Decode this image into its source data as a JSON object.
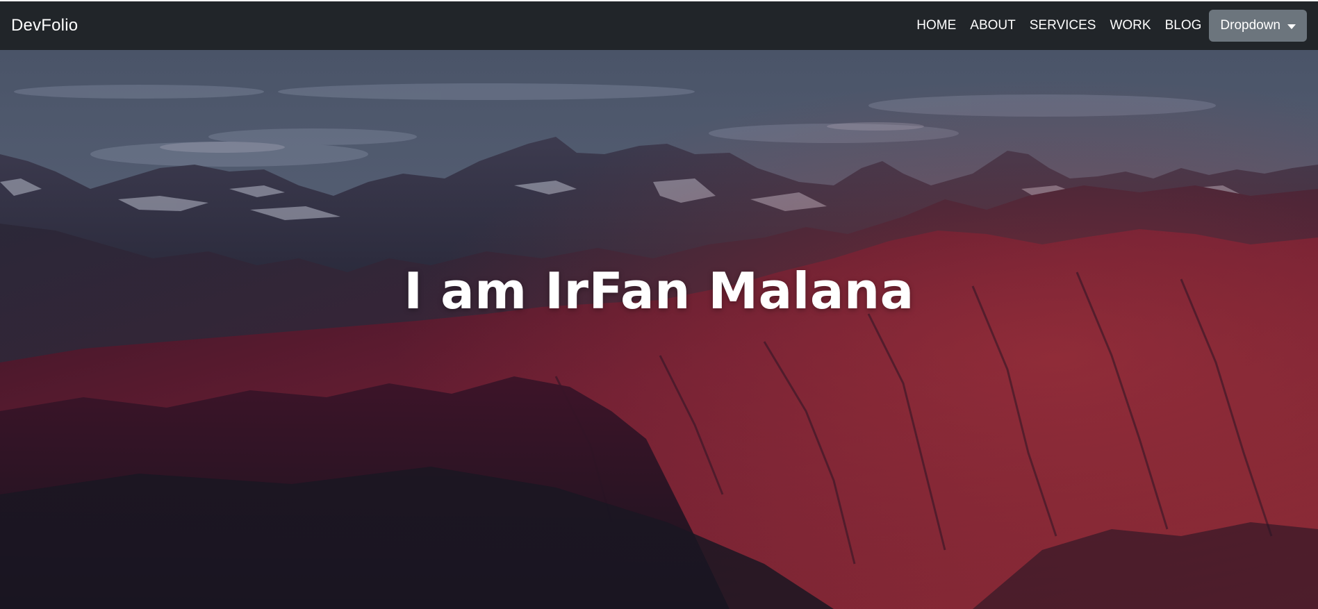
{
  "navbar": {
    "brand": "DevFolio",
    "links": [
      "HOME",
      "ABOUT",
      "SERVICES",
      "WORK",
      "BLOG"
    ],
    "dropdown_label": "Dropdown",
    "background": "#212529",
    "dropdown_background": "#6c757d"
  },
  "hero": {
    "title": "I am IrFan Malana",
    "background_image": "mountain-landscape-at-dusk"
  }
}
